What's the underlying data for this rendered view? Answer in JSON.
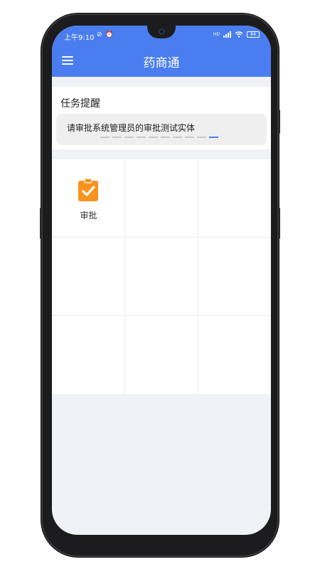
{
  "status_bar": {
    "time": "上午9:10",
    "extra": "⊘ ⏰",
    "signal_label": "HD",
    "battery": "84"
  },
  "header": {
    "title": "药商通"
  },
  "tasks": {
    "title": "任务提醒",
    "message": "请审批系统管理员的审批测试实体",
    "page_count": 10,
    "active_page": 10
  },
  "grid": {
    "items": [
      {
        "label": "审批",
        "icon": "clipboard-check-icon",
        "color": "#f7941d"
      }
    ]
  },
  "colors": {
    "primary": "#4a7df0",
    "approve": "#f7941d"
  }
}
